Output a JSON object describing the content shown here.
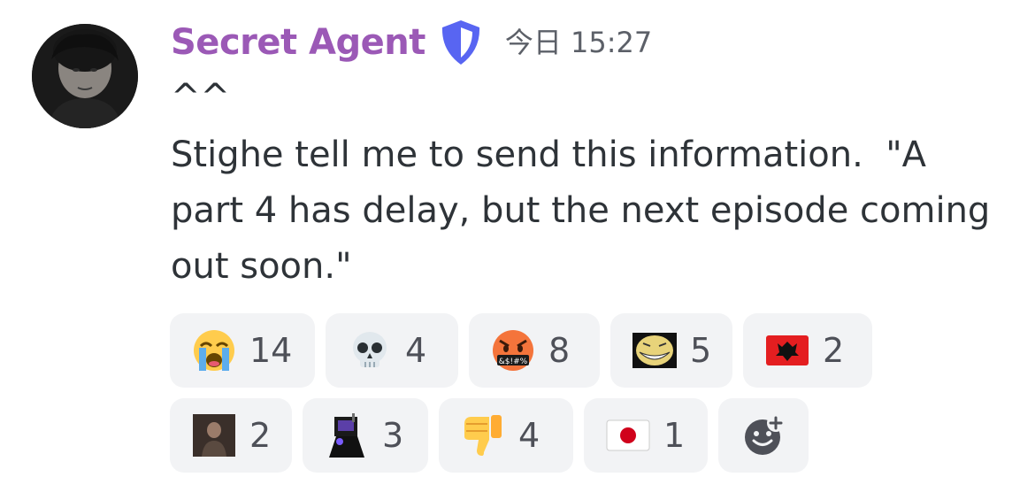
{
  "author": {
    "name": "Secret Agent",
    "avatar_icon": "profile-photo",
    "badge_icon": "shield-icon",
    "name_color": "#9b59b6"
  },
  "timestamp": "今日 15:27",
  "message": {
    "lines": [
      "^^",
      "Stighe tell me to send this information.  \"A",
      "part 4 has delay, but the next episode coming",
      "out soon.\""
    ]
  },
  "reactions": [
    {
      "icon": "loudly-crying-face",
      "count": "14"
    },
    {
      "icon": "skull",
      "count": "4"
    },
    {
      "icon": "face-with-symbols-on-mouth",
      "count": "8"
    },
    {
      "icon": "custom-trollface-emoji",
      "count": "5"
    },
    {
      "icon": "albania-flag",
      "count": "2"
    },
    {
      "icon": "custom-person-emoji",
      "count": "2"
    },
    {
      "icon": "custom-character-emoji",
      "count": "3"
    },
    {
      "icon": "thumbs-down",
      "count": "4"
    },
    {
      "icon": "japan-flag",
      "count": "1"
    }
  ],
  "add_reaction_icon": "add-reaction-icon",
  "colors": {
    "reaction_bg": "#f2f3f5",
    "badge_blue": "#5865f2"
  }
}
